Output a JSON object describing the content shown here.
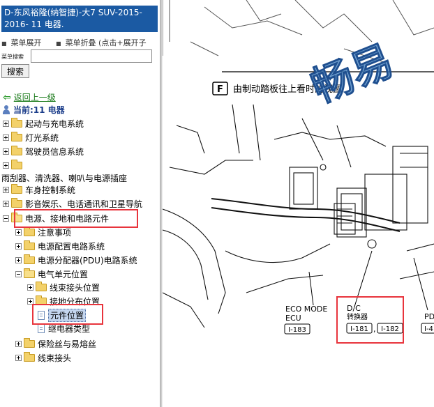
{
  "window": {
    "title": "D-东风裕隆(纳智捷)-大7 SUV-2015-2016- 11 电器."
  },
  "menu": {
    "expand_label": "菜单展开",
    "collapse_label": "菜单折叠 (点击+展开子"
  },
  "search": {
    "label": "菜单搜索",
    "value": "",
    "button_label": "搜索"
  },
  "nav": {
    "back_label": "返回上一级",
    "current_label": "当前:11 电器"
  },
  "tree": {
    "items": [
      {
        "label": "起动与充电系统"
      },
      {
        "label": "灯光系统"
      },
      {
        "label": "驾驶员信息系统"
      },
      {
        "label": ""
      },
      {
        "label": "雨刮器、清洗器、喇叭与电源插座"
      },
      {
        "label": "车身控制系统"
      },
      {
        "label": "影音娱乐、电话通讯和卫星导航"
      },
      {
        "label": "电源、接地和电路元件"
      },
      {
        "label": "注意事项"
      },
      {
        "label": "电源配置电路系统"
      },
      {
        "label": "电源分配器(PDU)电路系统"
      },
      {
        "label": "电气单元位置"
      },
      {
        "label": "线束接头位置"
      },
      {
        "label": "接地分布位置"
      },
      {
        "label": "元件位置"
      },
      {
        "label": "继电器类型"
      },
      {
        "label": "保险丝与易熔丝"
      },
      {
        "label": "线束接头"
      }
    ]
  },
  "diagram": {
    "view_letter": "F",
    "view_caption": "由制动踏板往上看时的视图",
    "watermark": "畅易",
    "labels": {
      "eco_mode_1": "ECO MODE",
      "eco_mode_2": "ECU",
      "eco_connector": "I-183",
      "dc_1": "D/C",
      "dc_2": "转换器",
      "dc_connector_1": "I-181",
      "dc_separator": ",",
      "dc_connector_2": "I-182",
      "pd_partial": "PD",
      "pd_connector_partial": "I-4"
    }
  },
  "colors": {
    "title_bar": "#1b5aa3",
    "highlight_box": "#e8343c",
    "back_link": "#1a7a1a",
    "current_label": "#1b3d8a",
    "watermark": "#3f7fbf"
  }
}
